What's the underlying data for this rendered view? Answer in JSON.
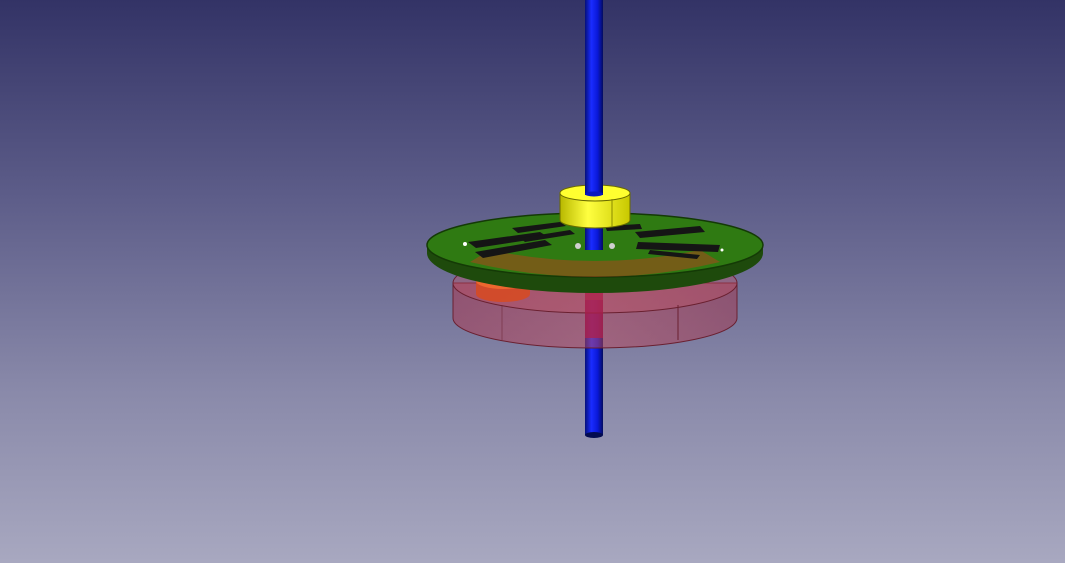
{
  "viewport": {
    "background_top": "#333366",
    "background_bottom": "#a8a8c0"
  },
  "model": {
    "parts": [
      {
        "name": "shaft",
        "color": "#0a1ae0"
      },
      {
        "name": "collar",
        "color": "#ffff22"
      },
      {
        "name": "disc-board",
        "color": "#2f7a12"
      },
      {
        "name": "housing",
        "color": "#c8323a"
      },
      {
        "name": "magnet",
        "color": "#e85020"
      }
    ]
  }
}
